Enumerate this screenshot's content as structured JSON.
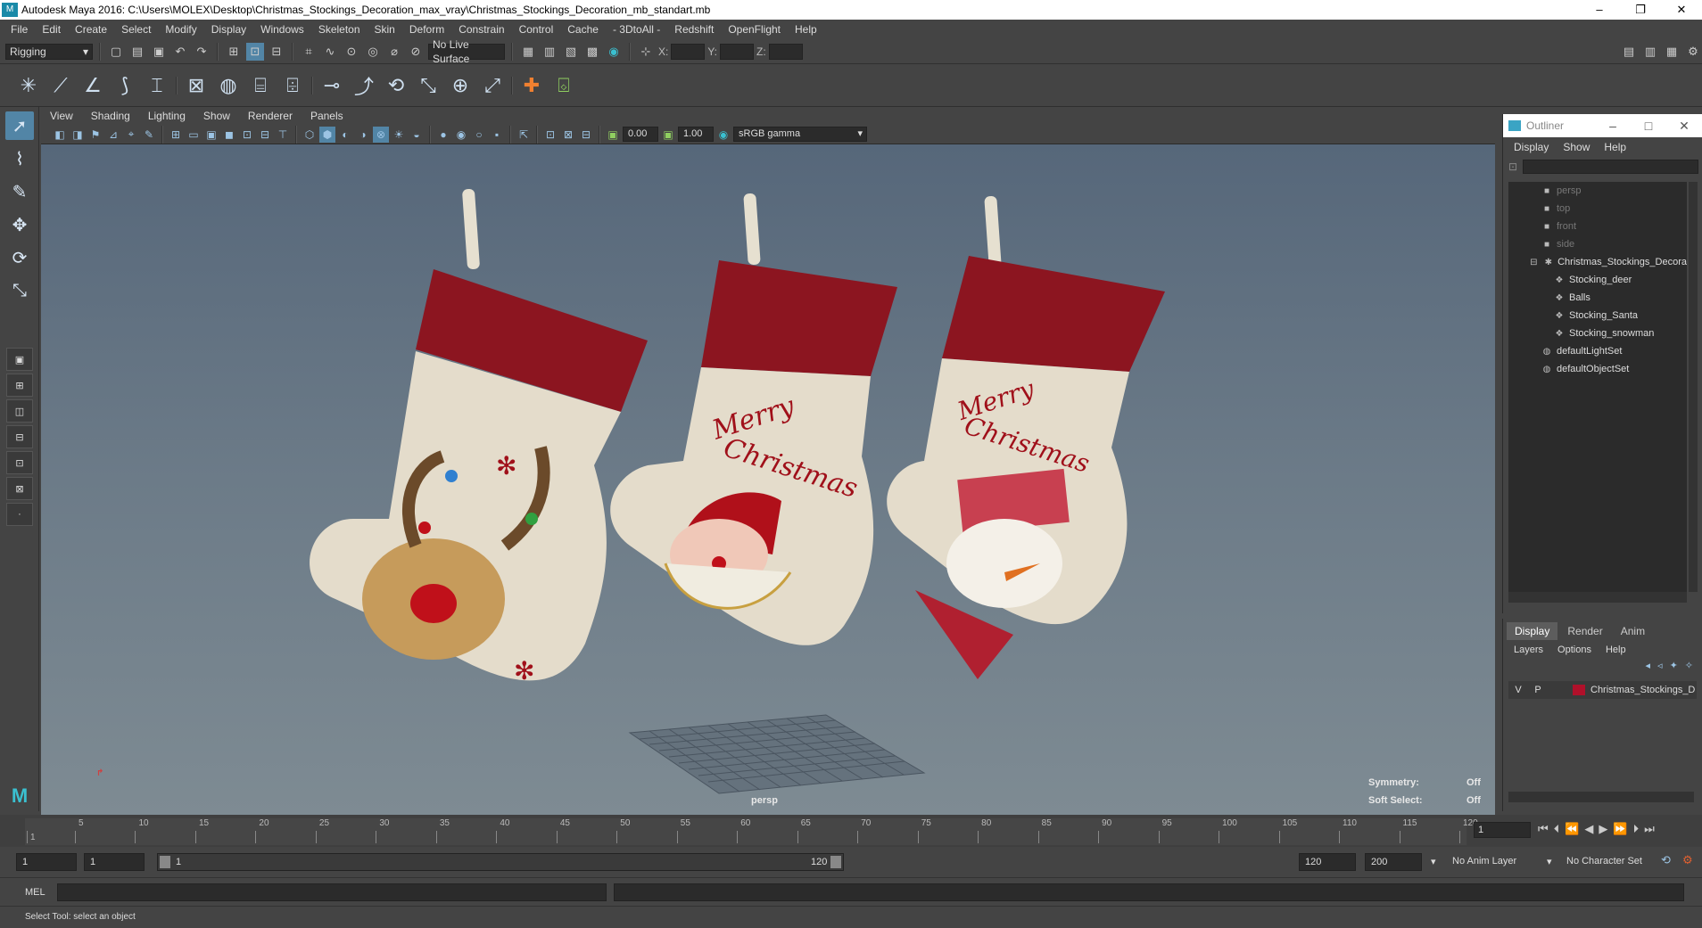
{
  "window": {
    "title": "Autodesk Maya 2016: C:\\Users\\MOLEX\\Desktop\\Christmas_Stockings_Decoration_max_vray\\Christmas_Stockings_Decoration_mb_standart.mb",
    "controls": [
      "–",
      "❐",
      "✕"
    ]
  },
  "menubar": [
    "File",
    "Edit",
    "Create",
    "Select",
    "Modify",
    "Display",
    "Windows",
    "Skeleton",
    "Skin",
    "Deform",
    "Constrain",
    "Control",
    "Cache",
    "- 3DtoAll -",
    "Redshift",
    "OpenFlight",
    "Help"
  ],
  "statusline": {
    "mode": "Rigging",
    "live_surface": "No Live Surface",
    "x_label": "X:",
    "y_label": "Y:",
    "z_label": "Z:"
  },
  "viewport": {
    "menu": [
      "View",
      "Shading",
      "Lighting",
      "Show",
      "Renderer",
      "Panels"
    ],
    "near_value": "0.00",
    "far_value": "1.00",
    "color_space": "sRGB gamma",
    "camera_label": "persp",
    "symmetry_label": "Symmetry:",
    "symmetry_value": "Off",
    "soft_select_label": "Soft Select:",
    "soft_select_value": "Off",
    "stocking_text_1": "Merry",
    "stocking_text_2": "Christmas"
  },
  "outliner": {
    "title": "Outliner",
    "menu": [
      "Display",
      "Show",
      "Help"
    ],
    "items": [
      {
        "label": "persp",
        "dim": true,
        "depth": 2,
        "icon": "camera-icon"
      },
      {
        "label": "top",
        "dim": true,
        "depth": 2,
        "icon": "camera-icon"
      },
      {
        "label": "front",
        "dim": true,
        "depth": 2,
        "icon": "camera-icon"
      },
      {
        "label": "side",
        "dim": true,
        "depth": 2,
        "icon": "camera-icon"
      },
      {
        "label": "Christmas_Stockings_Decora",
        "dim": false,
        "depth": 1,
        "icon": "group-icon"
      },
      {
        "label": "Stocking_deer",
        "dim": false,
        "depth": 3,
        "icon": "mesh-icon"
      },
      {
        "label": "Balls",
        "dim": false,
        "depth": 3,
        "icon": "mesh-icon"
      },
      {
        "label": "Stocking_Santa",
        "dim": false,
        "depth": 3,
        "icon": "mesh-icon"
      },
      {
        "label": "Stocking_snowman",
        "dim": false,
        "depth": 3,
        "icon": "mesh-icon"
      },
      {
        "label": "defaultLightSet",
        "dim": false,
        "depth": 2,
        "icon": "set-icon"
      },
      {
        "label": "defaultObjectSet",
        "dim": false,
        "depth": 2,
        "icon": "set-icon"
      }
    ]
  },
  "layers": {
    "tabs": [
      "Display",
      "Render",
      "Anim"
    ],
    "active_tab": "Display",
    "menu": [
      "Layers",
      "Options",
      "Help"
    ],
    "row": {
      "v": "V",
      "p": "P",
      "name": "Christmas_Stockings_D",
      "color": "#b0102a"
    }
  },
  "timeline": {
    "ticks": [
      "1",
      "5",
      "10",
      "15",
      "20",
      "25",
      "30",
      "35",
      "40",
      "45",
      "50",
      "55",
      "60",
      "65",
      "70",
      "75",
      "80",
      "85",
      "90",
      "95",
      "100",
      "105",
      "110",
      "115",
      "120"
    ],
    "current_frame": "1"
  },
  "range": {
    "start": "1",
    "current": "1",
    "slider_start": "1",
    "slider_end": "120",
    "end": "120",
    "max": "200",
    "anim_layer": "No Anim Layer",
    "character_set": "No Character Set"
  },
  "command": {
    "label": "MEL",
    "help": "Select Tool: select an object"
  }
}
